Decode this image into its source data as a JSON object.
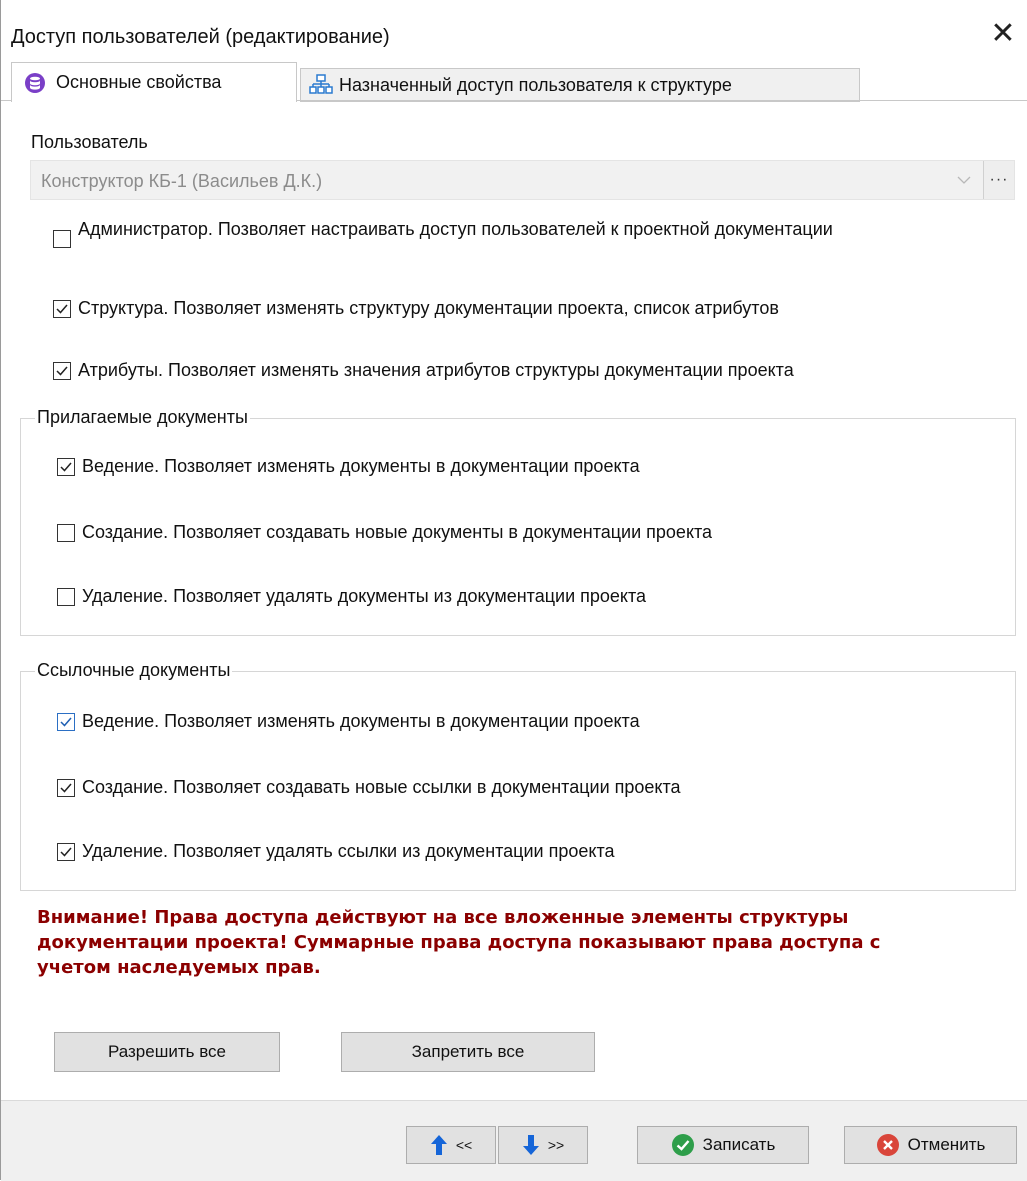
{
  "window": {
    "title": "Доступ пользователей (редактирование)"
  },
  "tabs": [
    {
      "label": "Основные свойства",
      "icon": "database-icon",
      "active": true
    },
    {
      "label": "Назначенный доступ пользователя к структуре",
      "icon": "hierarchy-icon",
      "active": false
    }
  ],
  "user": {
    "label": "Пользователь",
    "value": "Конструктор КБ-1 (Васильев Д.К.)",
    "more_label": "···"
  },
  "general": [
    {
      "label": "Администратор. Позволяет настраивать доступ пользователей к проектной документации",
      "checked": false
    },
    {
      "label": "Структура. Позволяет изменять структуру документации проекта, список атрибутов",
      "checked": true
    },
    {
      "label": "Атрибуты. Позволяет изменять значения атрибутов структуры документации проекта",
      "checked": true
    }
  ],
  "attached": {
    "title": "Прилагаемые документы",
    "items": [
      {
        "label": "Ведение. Позволяет изменять документы в документации проекта",
        "checked": true
      },
      {
        "label": "Создание. Позволяет создавать новые документы в документации проекта",
        "checked": false
      },
      {
        "label": "Удаление. Позволяет удалять документы из документации проекта",
        "checked": false
      }
    ]
  },
  "referenced": {
    "title": "Ссылочные документы",
    "items": [
      {
        "label": "Ведение. Позволяет изменять документы в документации проекта",
        "checked": true
      },
      {
        "label": "Создание. Позволяет создавать новые ссылки в документации проекта",
        "checked": true
      },
      {
        "label": "Удаление. Позволяет удалять ссылки из документации проекта",
        "checked": true
      }
    ]
  },
  "warning": {
    "line1": "Внимание!  Права доступа действуют на все вложенные элементы структуры",
    "line2": "документации проекта! Суммарные права доступа показывают права доступа с",
    "line3": "учетом наследуемых прав."
  },
  "buttons": {
    "allow_all": "Разрешить все",
    "deny_all": "Запретить все",
    "prev": "<<",
    "next": ">>",
    "save": "Записать",
    "cancel": "Отменить"
  },
  "colors": {
    "warning": "#8b0000",
    "accent_blue": "#1565d8",
    "save_green": "#2e9e4a",
    "cancel_red": "#d9453a"
  }
}
